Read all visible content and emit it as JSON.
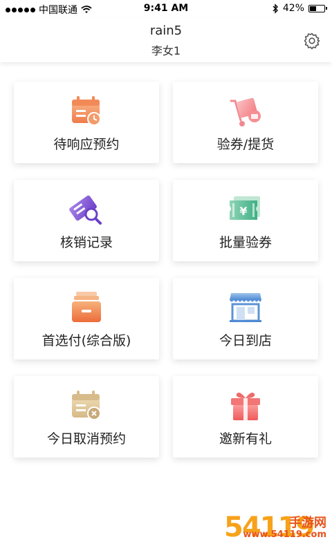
{
  "status_bar": {
    "carrier": "中国联通",
    "time": "9:41 AM",
    "battery": "42%",
    "battery_level": 0.42
  },
  "header": {
    "title": "rain5",
    "subtitle": "李女1"
  },
  "menu": [
    {
      "label": "待响应预约",
      "icon": "calendar-clock-icon"
    },
    {
      "label": "验券/提货",
      "icon": "cart-coupon-icon"
    },
    {
      "label": "核销记录",
      "icon": "ticket-search-icon"
    },
    {
      "label": "批量验券",
      "icon": "yen-ticket-icon"
    },
    {
      "label": "首选付(综合版)",
      "icon": "drawer-box-icon"
    },
    {
      "label": "今日到店",
      "icon": "storefront-icon"
    },
    {
      "label": "今日取消预约",
      "icon": "calendar-cancel-icon"
    },
    {
      "label": "邀新有礼",
      "icon": "gift-icon"
    }
  ],
  "watermark": {
    "number": "54119",
    "text": "手游网",
    "url": "www.54119.com"
  }
}
